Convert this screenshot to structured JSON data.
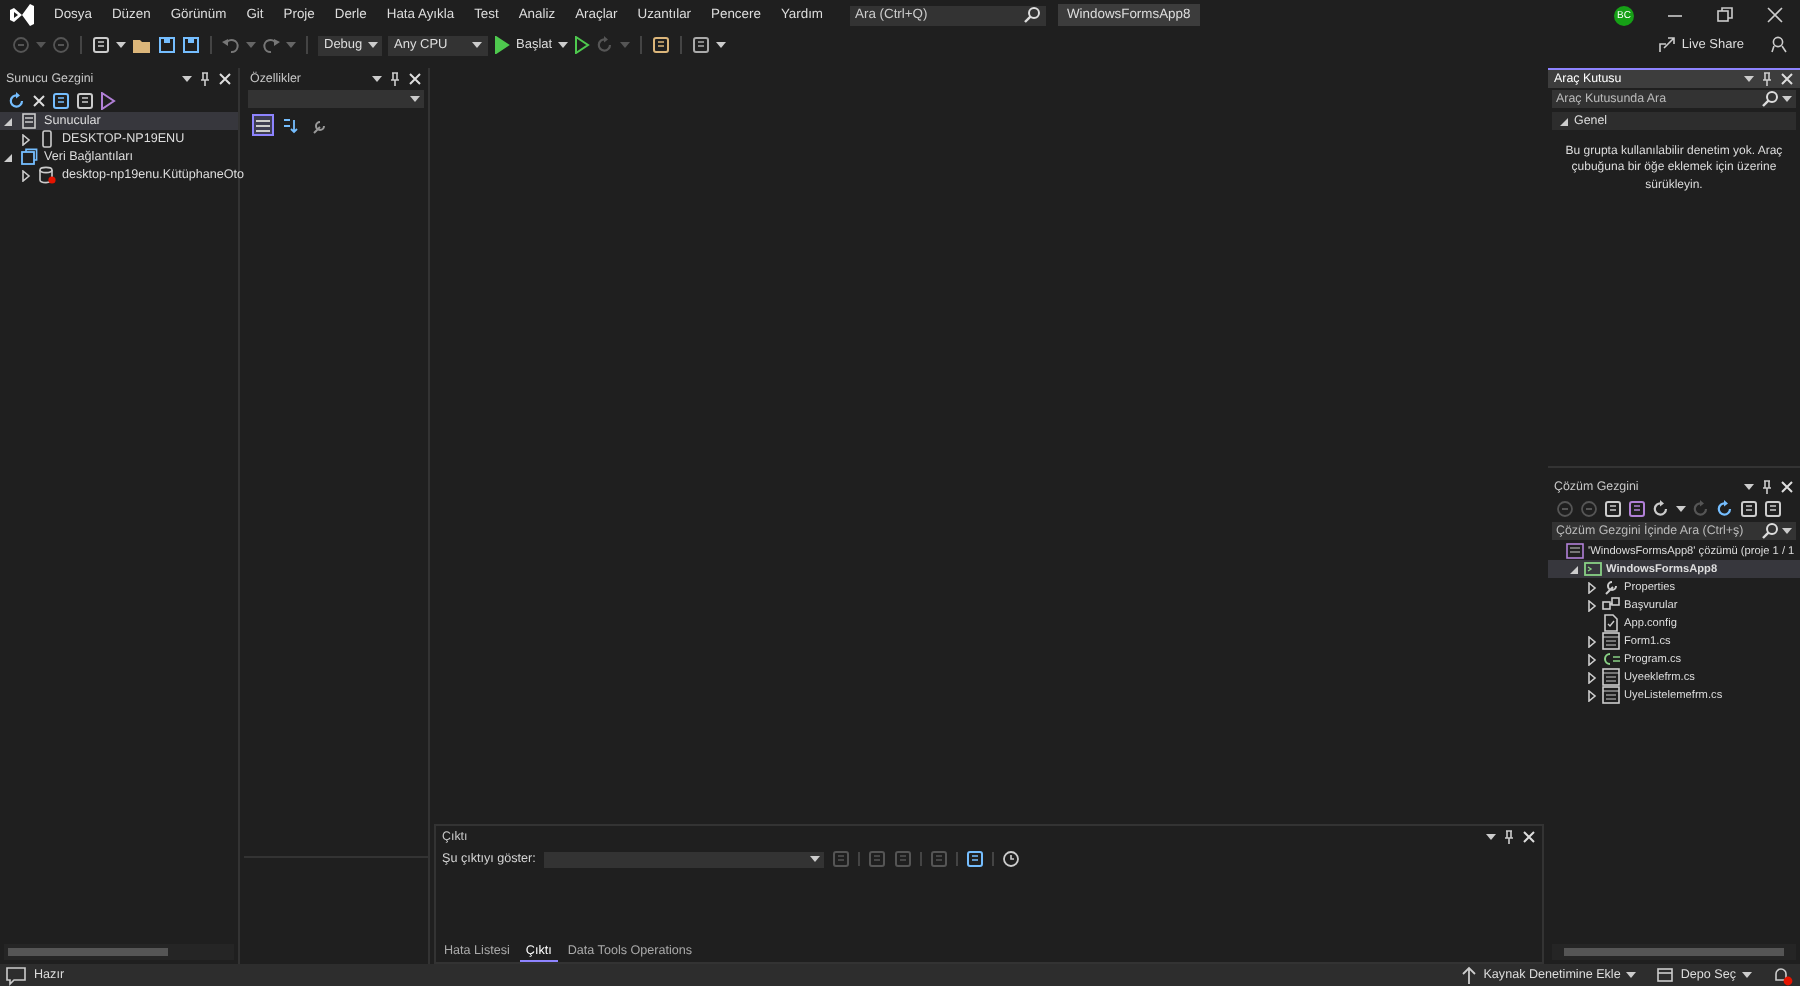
{
  "menu": {
    "items": [
      "Dosya",
      "Düzen",
      "Görünüm",
      "Git",
      "Proje",
      "Derle",
      "Hata Ayıkla",
      "Test",
      "Analiz",
      "Araçlar",
      "Uzantılar",
      "Pencere",
      "Yardım"
    ],
    "search": {
      "placeholder": "Ara (Ctrl+Q)"
    },
    "solution_name": "WindowsFormsApp8",
    "avatar": "BC"
  },
  "toolbar": {
    "configuration": "Debug",
    "platform": "Any CPU",
    "start": "Başlat",
    "live_share": "Live Share"
  },
  "server_explorer": {
    "title": "Sunucu Gezgini",
    "tree": [
      {
        "label": "Sunucular",
        "kind": "servers",
        "expanded": true,
        "selected": true,
        "children": [
          {
            "label": "DESKTOP-NP19ENU",
            "kind": "computer",
            "expanded": false,
            "selected": false
          }
        ]
      },
      {
        "label": "Veri Bağlantıları",
        "kind": "connections",
        "expanded": true,
        "selected": false,
        "children": [
          {
            "label": "desktop-np19enu.KütüphaneOto",
            "kind": "database",
            "expanded": false,
            "selected": false
          }
        ]
      }
    ]
  },
  "properties": {
    "title": "Özellikler",
    "tools": [
      {
        "kind": "categorized",
        "selected": true
      },
      {
        "kind": "alphabetical",
        "selected": false
      },
      {
        "kind": "pages",
        "selected": false
      }
    ]
  },
  "toolbox": {
    "title": "Araç Kutusu",
    "search": {
      "placeholder": "Araç Kutusunda Ara"
    },
    "group": {
      "label": "Genel",
      "expanded": true
    },
    "message": "Bu grupta kullanılabilir denetim yok. Araç çubuğuna bir öğe eklemek için üzerine sürükleyin."
  },
  "solution_explorer": {
    "title": "Çözüm Gezgini",
    "search": {
      "placeholder": "Çözüm Gezgini İçinde Ara (Ctrl+ş)"
    },
    "tree": [
      {
        "label": "'WindowsFormsApp8' çözümü (proje 1 / 1",
        "kind": "solution",
        "selected": false,
        "children": [
          {
            "label": "WindowsFormsApp8",
            "kind": "project",
            "expanded": true,
            "selected": true,
            "children": [
              {
                "label": "Properties",
                "kind": "properties",
                "expanded": false,
                "selected": false
              },
              {
                "label": "Başvurular",
                "kind": "references",
                "expanded": false,
                "selected": false
              },
              {
                "label": "App.config",
                "kind": "config",
                "selected": false
              },
              {
                "label": "Form1.cs",
                "kind": "form",
                "expanded": false,
                "selected": false
              },
              {
                "label": "Program.cs",
                "kind": "csharp",
                "expanded": false,
                "selected": false
              },
              {
                "label": "Uyeeklefrm.cs",
                "kind": "form",
                "expanded": false,
                "selected": false
              },
              {
                "label": "UyeListelemefrm.cs",
                "kind": "form",
                "expanded": false,
                "selected": false
              }
            ]
          }
        ]
      }
    ]
  },
  "output": {
    "title": "Çıktı",
    "show_label": "Şu çıktıyı göster:",
    "tabs": [
      {
        "label": "Hata Listesi",
        "selected": false
      },
      {
        "label": "Çıktı",
        "selected": true
      },
      {
        "label": "Data Tools Operations",
        "selected": false
      }
    ]
  },
  "status_bar": {
    "status": "Hazır",
    "source_control": "Kaynak Denetimine Ekle",
    "repository": "Depo Seç"
  }
}
